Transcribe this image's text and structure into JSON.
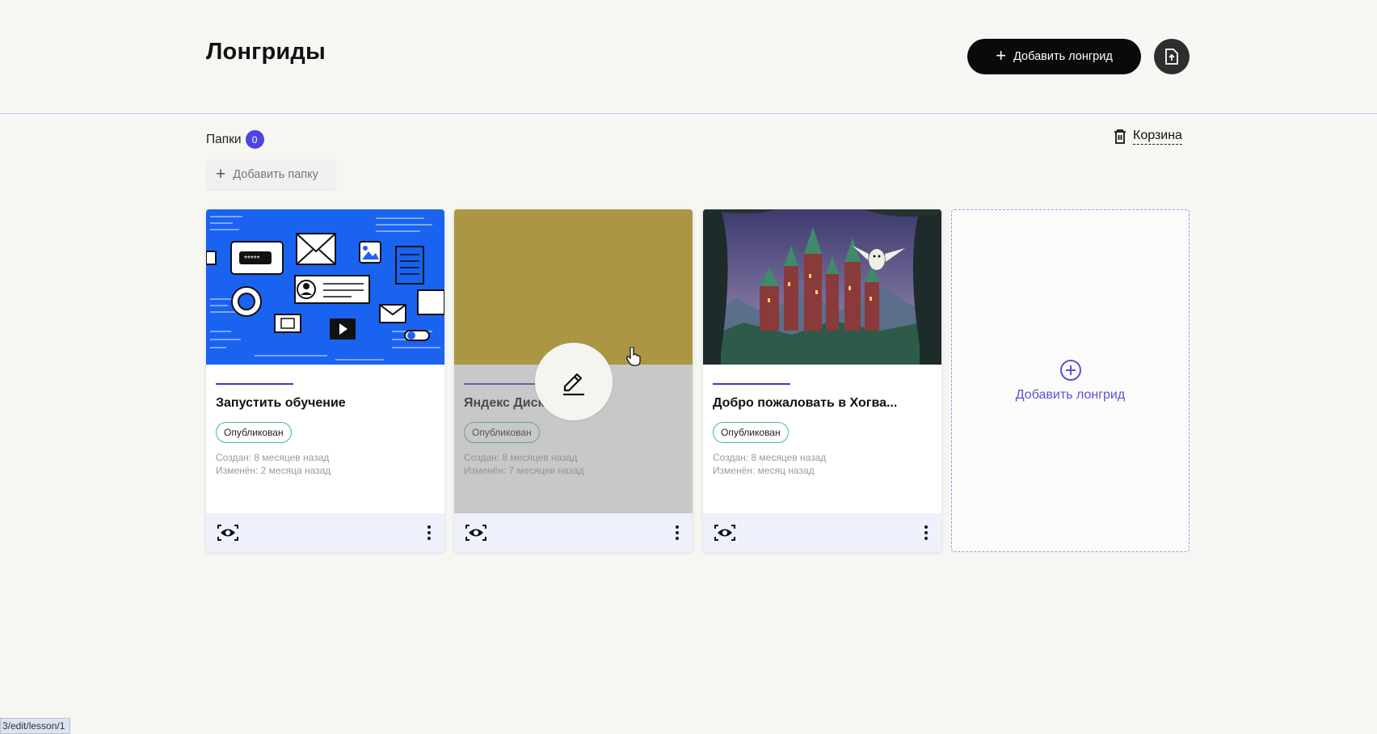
{
  "header": {
    "title": "Лонгриды",
    "add_button_label": "Добавить лонгрид"
  },
  "folders": {
    "label": "Папки",
    "count": "0",
    "add_folder_label": "Добавить папку"
  },
  "trash": {
    "label": "Корзина"
  },
  "cards": [
    {
      "title": "Запустить обучение",
      "status": "Опубликован",
      "created": "Создан: 8 месяцев назад",
      "modified": "Изменён: 2 месяца назад",
      "cover": "blue-digital-illustration"
    },
    {
      "title": "Яндекс Диск",
      "status": "Опубликован",
      "created": "Создан: 8 месяцев назад",
      "modified": "Изменён: 7 месяцев назад",
      "cover": "solid-mustard-color",
      "cover_color": "#c8a200",
      "hovered": true
    },
    {
      "title": "Добро пожаловать в Хогва...",
      "status": "Опубликован",
      "created": "Создан: 8 месяцев назад",
      "modified": "Изменён: месяц назад",
      "cover": "castle-owl-illustration"
    }
  ],
  "add_card": {
    "label": "Добавить лонгрид"
  },
  "statusbar": {
    "url": "3/edit/lesson/1"
  },
  "colors": {
    "accent": "#4c45e0",
    "status_border": "#3fb9a4",
    "footer_bg": "#eef0fb"
  }
}
